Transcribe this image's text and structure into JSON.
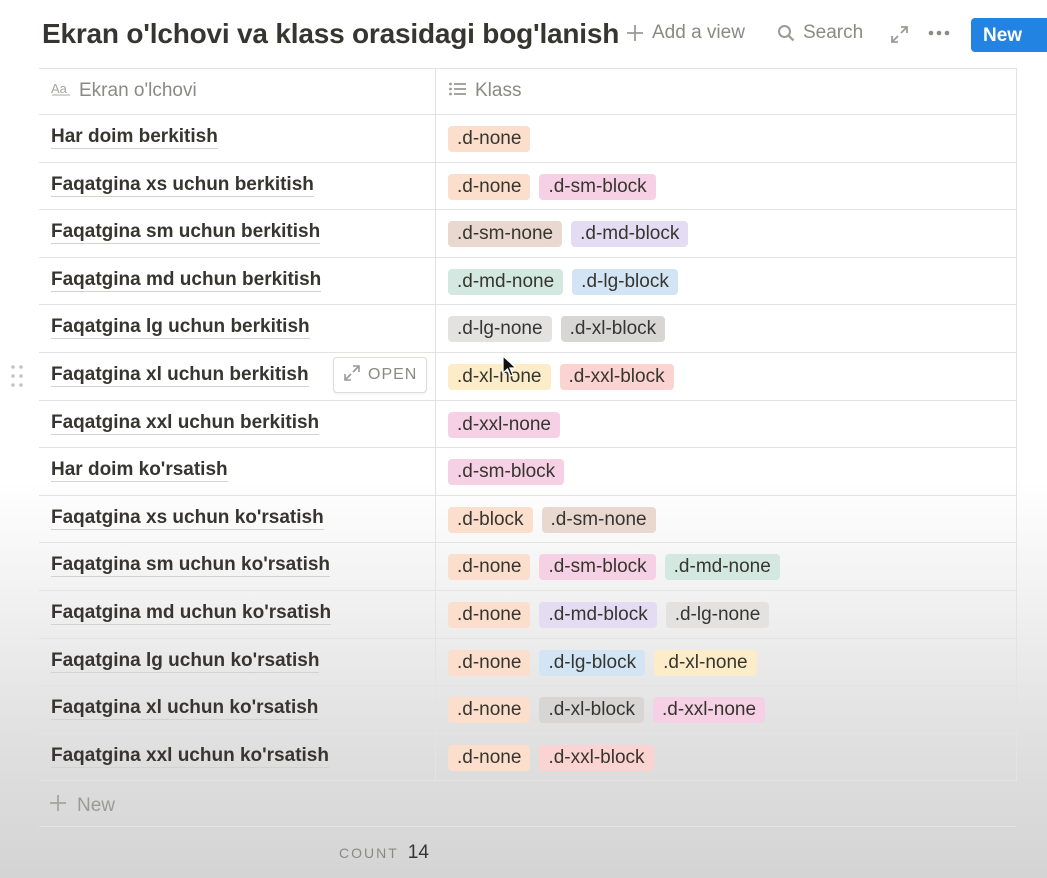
{
  "page": {
    "title": "Ekran o'lchovi va klass orasidagi bog'lanish"
  },
  "toolbar": {
    "add_view_label": "Add a view",
    "search_label": "Search",
    "new_label": "New",
    "icons": [
      "plus-icon",
      "search-icon",
      "expand-icon",
      "more-icon"
    ]
  },
  "table": {
    "columns": [
      {
        "label": "Ekran o'lchovi",
        "icon": "title-text-icon"
      },
      {
        "label": "Klass",
        "icon": "list-icon"
      }
    ],
    "rows": [
      {
        "title": "Har doim berkitish",
        "tags": [
          {
            "label": ".d-none",
            "color": "#fbdecc"
          }
        ]
      },
      {
        "title": "Faqatgina xs uchun berkitish",
        "tags": [
          {
            "label": ".d-none",
            "color": "#fbdecc"
          },
          {
            "label": ".d-sm-block",
            "color": "#f6d0e4"
          }
        ]
      },
      {
        "title": "Faqatgina sm uchun berkitish",
        "tags": [
          {
            "label": ".d-sm-none",
            "color": "#e8d8d0"
          },
          {
            "label": ".d-md-block",
            "color": "#e3dcf2"
          }
        ]
      },
      {
        "title": "Faqatgina md uchun berkitish",
        "tags": [
          {
            "label": ".d-md-none",
            "color": "#d2e8e1"
          },
          {
            "label": ".d-lg-block",
            "color": "#d3e5f5"
          }
        ]
      },
      {
        "title": "Faqatgina lg uchun berkitish",
        "tags": [
          {
            "label": ".d-lg-none",
            "color": "#e3e2e0"
          },
          {
            "label": ".d-xl-block",
            "color": "#d7d6d4"
          }
        ]
      },
      {
        "title": "Faqatgina xl uchun berkitish",
        "tags": [
          {
            "label": ".d-xl-none",
            "color": "#fcecc8"
          },
          {
            "label": ".d-xxl-block",
            "color": "#fbd3d0"
          }
        ],
        "hover_label": "OPEN"
      },
      {
        "title": "Faqatgina xxl uchun berkitish",
        "tags": [
          {
            "label": ".d-xxl-none",
            "color": "#f6d0e4"
          }
        ]
      },
      {
        "title": "Har doim ko'rsatish",
        "tags": [
          {
            "label": ".d-sm-block",
            "color": "#f6d0e4"
          }
        ]
      },
      {
        "title": "Faqatgina xs uchun ko'rsatish",
        "tags": [
          {
            "label": ".d-block",
            "color": "#fbdecc"
          },
          {
            "label": ".d-sm-none",
            "color": "#e8d8d0"
          }
        ]
      },
      {
        "title": "Faqatgina sm uchun ko'rsatish",
        "tags": [
          {
            "label": ".d-none",
            "color": "#fbdecc"
          },
          {
            "label": ".d-sm-block",
            "color": "#f6d0e4"
          },
          {
            "label": ".d-md-none",
            "color": "#d2e8e1"
          }
        ]
      },
      {
        "title": "Faqatgina md uchun ko'rsatish",
        "tags": [
          {
            "label": ".d-none",
            "color": "#fbdecc"
          },
          {
            "label": ".d-md-block",
            "color": "#e3dcf2"
          },
          {
            "label": ".d-lg-none",
            "color": "#e3e2e0"
          }
        ]
      },
      {
        "title": "Faqatgina lg uchun ko'rsatish",
        "tags": [
          {
            "label": ".d-none",
            "color": "#fbdecc"
          },
          {
            "label": ".d-lg-block",
            "color": "#d3e5f5"
          },
          {
            "label": ".d-xl-none",
            "color": "#fcecc8"
          }
        ]
      },
      {
        "title": "Faqatgina xl uchun ko'rsatish",
        "tags": [
          {
            "label": ".d-none",
            "color": "#fbdecc"
          },
          {
            "label": ".d-xl-block",
            "color": "#d7d6d4"
          },
          {
            "label": ".d-xxl-none",
            "color": "#f6d0e4"
          }
        ]
      },
      {
        "title": "Faqatgina xxl uchun ko'rsatish",
        "tags": [
          {
            "label": ".d-none",
            "color": "#fbdecc"
          },
          {
            "label": ".d-xxl-block",
            "color": "#fbd3d0"
          }
        ]
      }
    ],
    "new_row_label": "New",
    "count_label": "COUNT",
    "count_value": "14"
  }
}
